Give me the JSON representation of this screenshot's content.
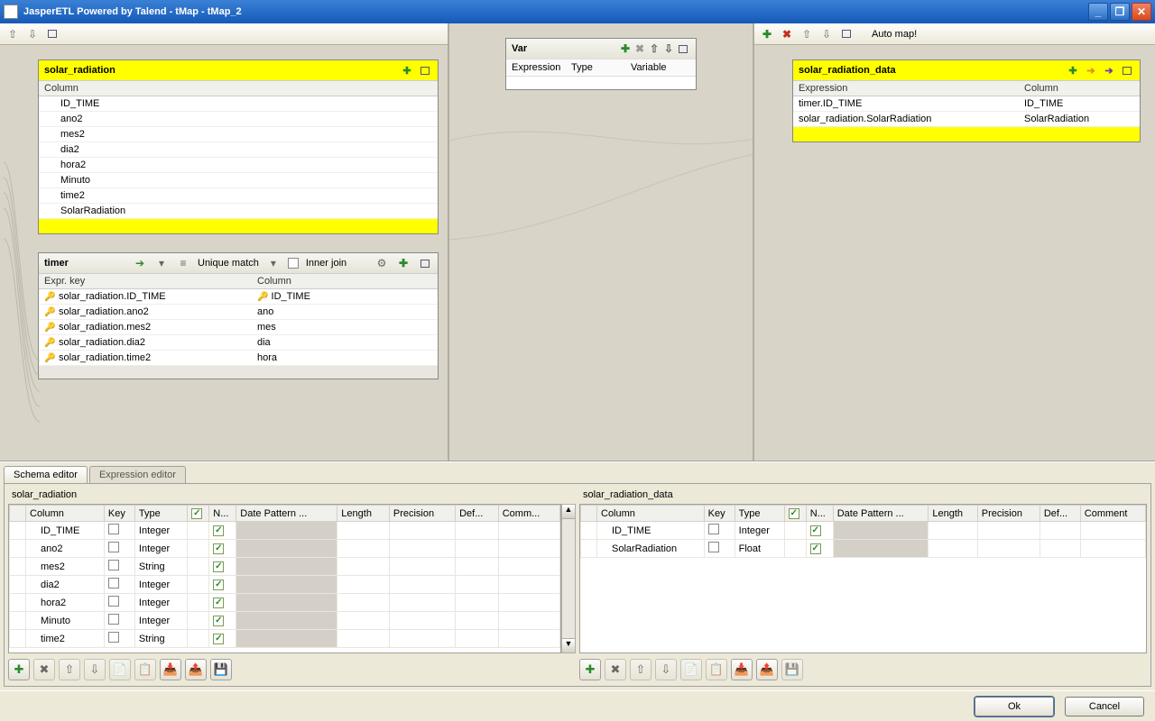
{
  "titlebar": {
    "title": "JasperETL Powered by Talend - tMap - tMap_2"
  },
  "automap_label": "Auto map!",
  "var_panel": {
    "title": "Var",
    "cols": {
      "expr": "Expression",
      "type": "Type",
      "var": "Variable"
    }
  },
  "input_main": {
    "name": "solar_radiation",
    "col_label": "Column",
    "rows": [
      "ID_TIME",
      "ano2",
      "mes2",
      "dia2",
      "hora2",
      "Minuto",
      "time2",
      "SolarRadiation"
    ]
  },
  "input_lookup": {
    "name": "timer",
    "match_label": "Unique match",
    "inner_join_label": "Inner join",
    "expr_label": "Expr. key",
    "col_label": "Column",
    "rows": [
      {
        "expr": "solar_radiation.ID_TIME",
        "col": "ID_TIME",
        "pk": true
      },
      {
        "expr": "solar_radiation.ano2",
        "col": "ano",
        "pk": false
      },
      {
        "expr": "solar_radiation.mes2",
        "col": "mes",
        "pk": false
      },
      {
        "expr": "solar_radiation.dia2",
        "col": "dia",
        "pk": false
      },
      {
        "expr": "solar_radiation.time2",
        "col": "hora",
        "pk": false
      }
    ]
  },
  "output": {
    "name": "solar_radiation_data",
    "expr_label": "Expression",
    "col_label": "Column",
    "rows": [
      {
        "expr": "timer.ID_TIME",
        "col": "ID_TIME"
      },
      {
        "expr": "solar_radiation.SolarRadiation",
        "col": "SolarRadiation"
      }
    ]
  },
  "tabs": {
    "schema": "Schema editor",
    "expr": "Expression editor"
  },
  "schema_left": {
    "title": "solar_radiation",
    "headers": {
      "col": "Column",
      "key": "Key",
      "type": "Type",
      "n": "N...",
      "dp": "Date Pattern ...",
      "len": "Length",
      "prec": "Precision",
      "def": "Def...",
      "com": "Comm..."
    },
    "rows": [
      {
        "col": "ID_TIME",
        "type": "Integer",
        "n": true
      },
      {
        "col": "ano2",
        "type": "Integer",
        "n": true
      },
      {
        "col": "mes2",
        "type": "String",
        "n": true
      },
      {
        "col": "dia2",
        "type": "Integer",
        "n": true
      },
      {
        "col": "hora2",
        "type": "Integer",
        "n": true
      },
      {
        "col": "Minuto",
        "type": "Integer",
        "n": true
      },
      {
        "col": "time2",
        "type": "String",
        "n": true
      }
    ]
  },
  "schema_right": {
    "title": "solar_radiation_data",
    "headers": {
      "col": "Column",
      "key": "Key",
      "type": "Type",
      "n": "N...",
      "dp": "Date Pattern ...",
      "len": "Length",
      "prec": "Precision",
      "def": "Def...",
      "com": "Comment"
    },
    "rows": [
      {
        "col": "ID_TIME",
        "type": "Integer",
        "n": true
      },
      {
        "col": "SolarRadiation",
        "type": "Float",
        "n": true
      }
    ]
  },
  "buttons": {
    "ok": "Ok",
    "cancel": "Cancel"
  }
}
